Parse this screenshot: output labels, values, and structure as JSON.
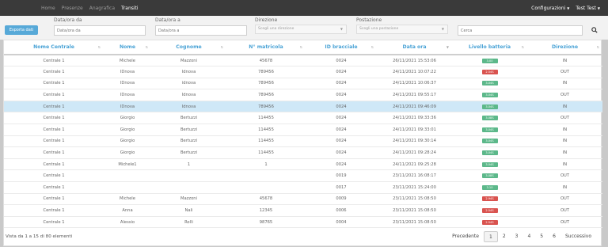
{
  "nav": {
    "items": [
      "Home",
      "Presenze",
      "Anagrafica",
      "Transiti"
    ],
    "active": "Transiti",
    "config_label": "Configurazioni",
    "user_label": "Test Test"
  },
  "filters": {
    "date_from_label": "Data/ora da",
    "date_from_placeholder": "Data/ora da",
    "date_to_label": "Data/ora a",
    "date_to_placeholder": "Data/ora a",
    "direction_label": "Direzione",
    "direction_placeholder": "Scegli una direzione",
    "station_label": "Postazione",
    "station_placeholder": "Scegli una postazione",
    "search_placeholder": "Cerca",
    "export_label": "Esporta dati"
  },
  "table": {
    "headers": [
      "Nome Centrale",
      "Nome",
      "Cognome",
      "N° matricola",
      "ID bracciale",
      "Data ora",
      "Livello batteria",
      "Direzione"
    ],
    "rows": [
      {
        "centrale": "Centrale 1",
        "nome": "Michele",
        "cognome": "Mazzoni",
        "matricola": "45678",
        "bracciale": "0024",
        "data": "26/11/2021 15:53:06",
        "batteria": "3.00",
        "bat_color": "green",
        "direzione": "IN"
      },
      {
        "centrale": "Centrale 1",
        "nome": "IDnova",
        "cognome": "Idnova",
        "matricola": "789456",
        "bracciale": "0024",
        "data": "24/11/2021 10:07:22",
        "batteria": "2.54S",
        "bat_color": "red",
        "direzione": "OUT"
      },
      {
        "centrale": "Centrale 1",
        "nome": "IDnova",
        "cognome": "idnova",
        "matricola": "789456",
        "bracciale": "0024",
        "data": "24/11/2021 10:06:37",
        "batteria": "3.04S",
        "bat_color": "green",
        "direzione": "IN"
      },
      {
        "centrale": "Centrale 1",
        "nome": "IDnova",
        "cognome": "Idnova",
        "matricola": "789456",
        "bracciale": "0024",
        "data": "24/11/2021 09:55:17",
        "batteria": "3.04S",
        "bat_color": "green",
        "direzione": "OUT"
      },
      {
        "centrale": "Centrale 1",
        "nome": "IDnova",
        "cognome": "Idnova",
        "matricola": "789456",
        "bracciale": "0024",
        "data": "24/11/2021 09:46:09",
        "batteria": "3.04S",
        "bat_color": "green",
        "direzione": "IN",
        "highlight": true
      },
      {
        "centrale": "Centrale 1",
        "nome": "Giorgio",
        "cognome": "Bertuzzi",
        "matricola": "114455",
        "bracciale": "0024",
        "data": "24/11/2021 09:33:36",
        "batteria": "3.08S",
        "bat_color": "green",
        "direzione": "OUT"
      },
      {
        "centrale": "Centrale 1",
        "nome": "Giorgio",
        "cognome": "Bertuzzi",
        "matricola": "114455",
        "bracciale": "0024",
        "data": "24/11/2021 09:33:01",
        "batteria": "3.04S",
        "bat_color": "green",
        "direzione": "IN"
      },
      {
        "centrale": "Centrale 1",
        "nome": "Giorgio",
        "cognome": "Bertuzzi",
        "matricola": "114455",
        "bracciale": "0024",
        "data": "24/11/2021 09:30:14",
        "batteria": "3.04S",
        "bat_color": "green",
        "direzione": "IN"
      },
      {
        "centrale": "Centrale 1",
        "nome": "Giorgio",
        "cognome": "Bertuzzi",
        "matricola": "114455",
        "bracciale": "0024",
        "data": "24/11/2021 09:28:24",
        "batteria": "3.04S",
        "bat_color": "green",
        "direzione": "IN"
      },
      {
        "centrale": "Centrale 1",
        "nome": "Michele1",
        "cognome": "1",
        "matricola": "1",
        "bracciale": "0024",
        "data": "24/11/2021 09:25:28",
        "batteria": "3.04S",
        "bat_color": "green",
        "direzione": "IN"
      },
      {
        "centrale": "Centrale 1",
        "nome": "",
        "cognome": "",
        "matricola": "",
        "bracciale": "0019",
        "data": "23/11/2021 16:08:17",
        "batteria": "3.08S",
        "bat_color": "green",
        "direzione": "OUT"
      },
      {
        "centrale": "Centrale 1",
        "nome": "",
        "cognome": "",
        "matricola": "",
        "bracciale": "0017",
        "data": "23/11/2021 15:24:00",
        "batteria": "3.10",
        "bat_color": "green",
        "direzione": "IN"
      },
      {
        "centrale": "Centrale 1",
        "nome": "Michele",
        "cognome": "Mazzoni",
        "matricola": "45678",
        "bracciale": "0009",
        "data": "23/11/2021 15:08:50",
        "batteria": "2.94S",
        "bat_color": "red",
        "direzione": "OUT"
      },
      {
        "centrale": "Centrale 1",
        "nome": "Anna",
        "cognome": "Nali",
        "matricola": "12345",
        "bracciale": "0006",
        "data": "23/11/2021 15:08:50",
        "batteria": "2.54S",
        "bat_color": "red",
        "direzione": "OUT"
      },
      {
        "centrale": "Centrale 1",
        "nome": "Alessio",
        "cognome": "Rolli",
        "matricola": "98765",
        "bracciale": "0004",
        "data": "23/11/2021 15:08:50",
        "batteria": "2.54S",
        "bat_color": "red",
        "direzione": "OUT"
      }
    ]
  },
  "footer": {
    "info": "Vista da 1 a 15 di 80 elementi",
    "prev": "Precedente",
    "pages": [
      "1",
      "2",
      "3",
      "4",
      "5",
      "6"
    ],
    "current_page": "1",
    "next": "Successivo"
  },
  "colors": {
    "accent": "#4aa3d6",
    "button": "#57a9d8",
    "battery_ok": "#5cb88a",
    "battery_low": "#d9534f",
    "row_highlight": "#cfe8f7",
    "navbar": "#3a3a3a"
  }
}
